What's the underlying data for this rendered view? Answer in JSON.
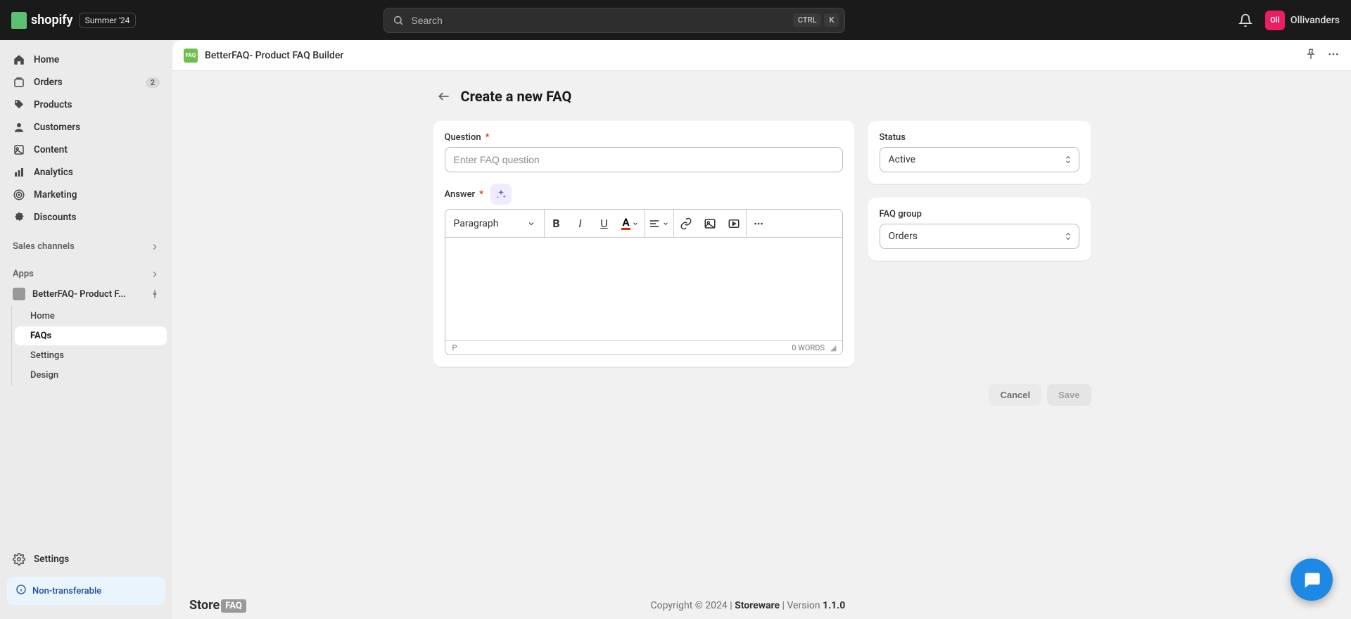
{
  "topbar": {
    "brand": "shopify",
    "badge": "Summer '24",
    "search_placeholder": "Search",
    "kbd1": "CTRL",
    "kbd2": "K",
    "user_initials": "Oll",
    "user_name": "Ollivanders"
  },
  "sidebar": {
    "nav": [
      {
        "label": "Home",
        "badge": ""
      },
      {
        "label": "Orders",
        "badge": "2"
      },
      {
        "label": "Products",
        "badge": ""
      },
      {
        "label": "Customers",
        "badge": ""
      },
      {
        "label": "Content",
        "badge": ""
      },
      {
        "label": "Analytics",
        "badge": ""
      },
      {
        "label": "Marketing",
        "badge": ""
      },
      {
        "label": "Discounts",
        "badge": ""
      }
    ],
    "section_sales": "Sales channels",
    "section_apps": "Apps",
    "app_name": "BetterFAQ- Product F...",
    "app_sub": [
      {
        "label": "Home"
      },
      {
        "label": "FAQs"
      },
      {
        "label": "Settings"
      },
      {
        "label": "Design"
      }
    ],
    "settings_label": "Settings",
    "non_transferable": "Non-transferable"
  },
  "app_header": {
    "logo_text": "FAQ",
    "title": "BetterFAQ- Product FAQ Builder"
  },
  "page": {
    "title": "Create a new FAQ",
    "question_label": "Question",
    "question_placeholder": "Enter FAQ question",
    "answer_label": "Answer",
    "paragraph_label": "Paragraph",
    "rte_p": "P",
    "rte_words": "0 WORDS",
    "status_label": "Status",
    "status_value": "Active",
    "group_label": "FAQ group",
    "group_value": "Orders",
    "cancel": "Cancel",
    "save": "Save"
  },
  "footer": {
    "store": "Store",
    "faq": "FAQ",
    "copyright_pre": "Copyright © 2024 | ",
    "storeware": "Storeware",
    "version_pre": " | Version ",
    "version": "1.1.0"
  }
}
